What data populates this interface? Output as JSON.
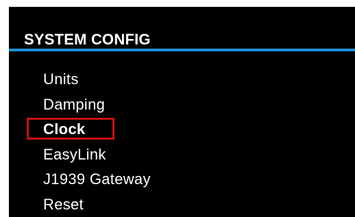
{
  "header": {
    "title": "SYSTEM CONFIG"
  },
  "menu": {
    "items": [
      {
        "label": "Units",
        "selected": false
      },
      {
        "label": "Damping",
        "selected": false
      },
      {
        "label": "Clock",
        "selected": true
      },
      {
        "label": "EasyLink",
        "selected": false
      },
      {
        "label": "J1939 Gateway",
        "selected": false
      },
      {
        "label": "Reset",
        "selected": false
      }
    ]
  },
  "colors": {
    "background": "#000000",
    "text": "#ffffff",
    "accent_rule": "#1e90d6",
    "selection_highlight": "#cc1111"
  }
}
